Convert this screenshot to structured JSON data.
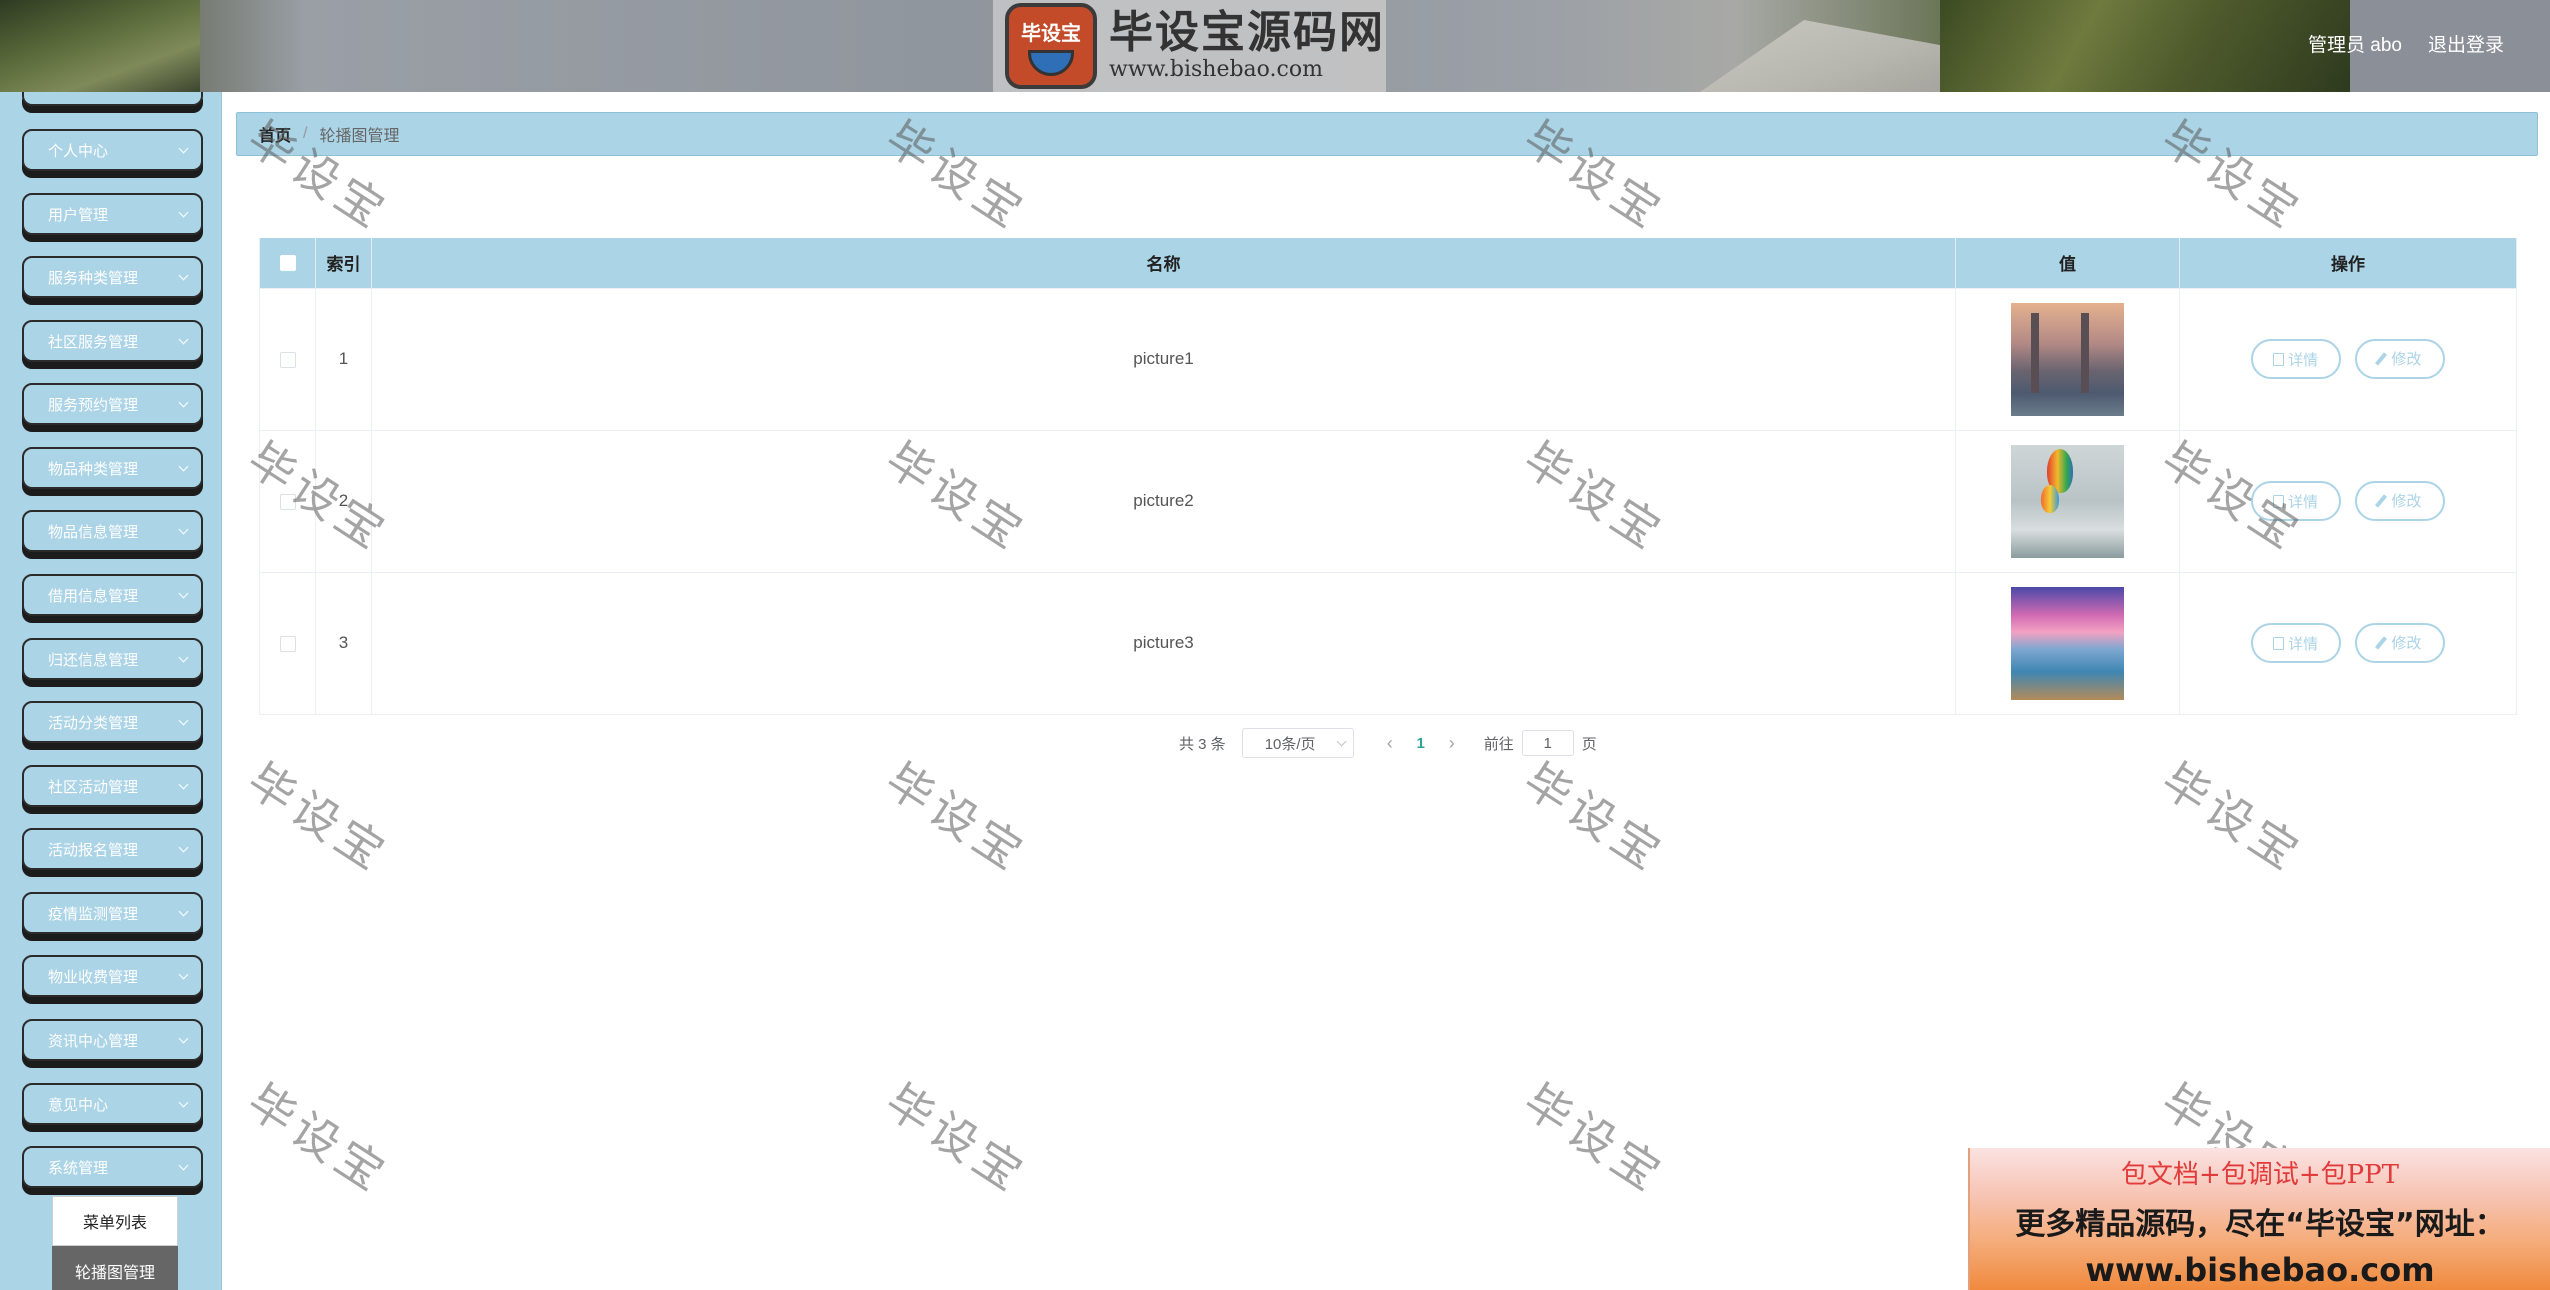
{
  "header": {
    "brand_seal_text": "毕设宝",
    "brand_title": "毕设宝源码网",
    "brand_url": "www.bishebao.com",
    "user_label": "管理员 abo",
    "logout_label": "退出登录"
  },
  "sidebar": {
    "items": [
      {
        "label": "个人中心"
      },
      {
        "label": "用户管理"
      },
      {
        "label": "服务种类管理"
      },
      {
        "label": "社区服务管理"
      },
      {
        "label": "服务预约管理"
      },
      {
        "label": "物品种类管理"
      },
      {
        "label": "物品信息管理"
      },
      {
        "label": "借用信息管理"
      },
      {
        "label": "归还信息管理"
      },
      {
        "label": "活动分类管理"
      },
      {
        "label": "社区活动管理"
      },
      {
        "label": "活动报名管理"
      },
      {
        "label": "疫情监测管理"
      },
      {
        "label": "物业收费管理"
      },
      {
        "label": "资讯中心管理"
      },
      {
        "label": "意见中心"
      },
      {
        "label": "系统管理"
      }
    ],
    "submenu": [
      {
        "label": "菜单列表"
      },
      {
        "label": "轮播图管理"
      }
    ]
  },
  "breadcrumb": {
    "home": "首页",
    "separator": "/",
    "current": "轮播图管理"
  },
  "table": {
    "columns": [
      "",
      "索引",
      "名称",
      "值",
      "操作"
    ],
    "rows": [
      {
        "index": "1",
        "name": "picture1",
        "image": "bridge-city-photo"
      },
      {
        "index": "2",
        "name": "picture2",
        "image": "hot-air-balloons-photo"
      },
      {
        "index": "3",
        "name": "picture3",
        "image": "sunset-pier-photo"
      }
    ],
    "actions": {
      "detail": "详情",
      "edit": "修改"
    }
  },
  "pagination": {
    "total": "共 3 条",
    "page_size": "10条/页",
    "current_page": "1",
    "goto_label": "前往",
    "goto_value": "1",
    "page_suffix": "页"
  },
  "watermark": "毕设宝",
  "promo": {
    "line1": "包文档+包调试+包PPT",
    "line2": "更多精品源码，尽在“毕设宝”网址：",
    "line3": "www.bishebao.com"
  },
  "colors": {
    "accent": "#abd4e6",
    "active_submenu": "#666666",
    "pagination_active": "#2fa59a"
  }
}
